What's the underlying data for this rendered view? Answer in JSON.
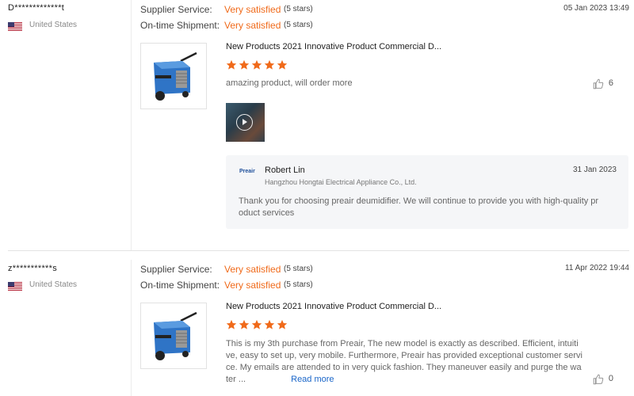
{
  "colors": {
    "accent": "#f06a1a",
    "link": "#1a66c9",
    "star": "#f06a1a"
  },
  "rating_labels": {
    "supplier_service": "Supplier Service:",
    "ontime_shipment": "On-time Shipment:"
  },
  "reviews": [
    {
      "buyer": "D*************t",
      "country": "United States",
      "date": "05 Jan 2023 13:49",
      "supplier_service": "Very satisfied",
      "supplier_service_stars": "(5 stars)",
      "ontime_shipment": "Very satisfied",
      "ontime_shipment_stars": "(5 stars)",
      "product_title": "New Products 2021 Innovative Product Commercial D...",
      "stars": 5,
      "text": "amazing product,  will order more",
      "likes": "6",
      "reply": {
        "logo": "Preair",
        "name": "Robert Lin",
        "company": "Hangzhou Hongtai Electrical Appliance Co., Ltd.",
        "date": "31 Jan 2023",
        "text": "Thank you for choosing preair deumidifier. We will continue to provide you with high-quality pr oduct services"
      }
    },
    {
      "buyer": "z***********s",
      "country": "United States",
      "date": "11 Apr 2022 19:44",
      "supplier_service": "Very satisfied",
      "supplier_service_stars": "(5 stars)",
      "ontime_shipment": "Very satisfied",
      "ontime_shipment_stars": "(5 stars)",
      "product_title": "New Products 2021 Innovative Product Commercial D...",
      "stars": 5,
      "text": "This is my 3th purchase from Preair, The new model is exactly as described. Efficient, intuiti ve, easy to set up, very mobile. Furthermore, Preair has provided exceptional customer servi ce. My emails are attended to in very quick fashion. They maneuver easily and purge the wa ter ...",
      "read_more": "Read more",
      "likes": "0"
    }
  ]
}
